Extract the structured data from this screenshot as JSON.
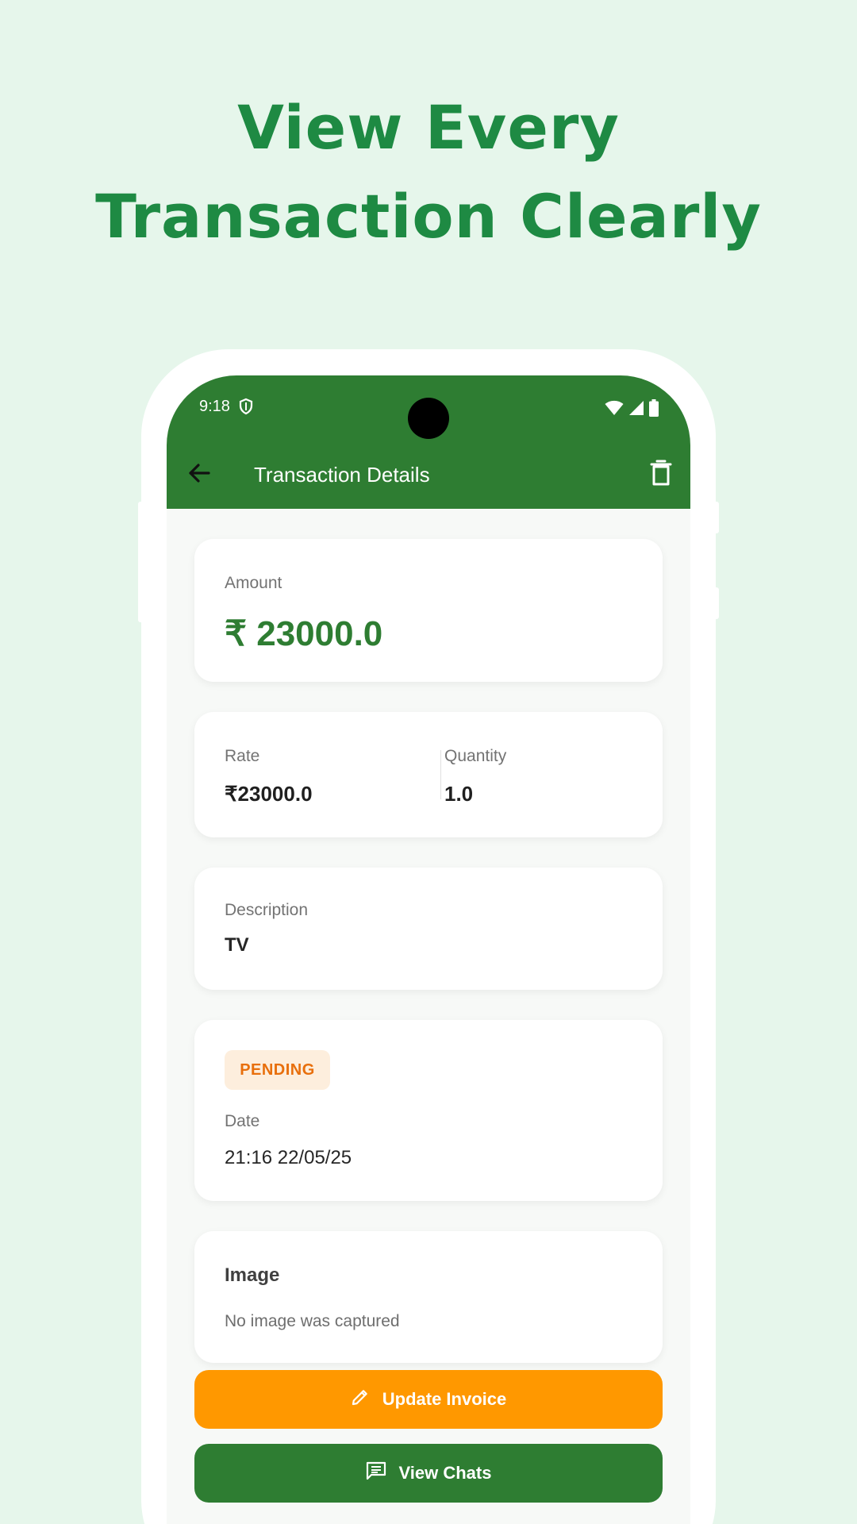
{
  "headline": {
    "line1": "View Every",
    "line2": "Transaction Clearly"
  },
  "status_bar": {
    "time": "9:18"
  },
  "appbar": {
    "title": "Transaction Details"
  },
  "amount": {
    "label": "Amount",
    "value": "₹ 23000.0"
  },
  "rate": {
    "label": "Rate",
    "value": "₹23000.0"
  },
  "quantity": {
    "label": "Quantity",
    "value": "1.0"
  },
  "description": {
    "label": "Description",
    "value": "TV"
  },
  "status": {
    "badge": "PENDING",
    "date_label": "Date",
    "date_value": "21:16 22/05/25"
  },
  "image": {
    "title": "Image",
    "note": "No image was captured"
  },
  "actions": {
    "update_label": "Update Invoice",
    "chats_label": "View Chats"
  },
  "colors": {
    "primary": "#2e7d32",
    "accent": "#ff9800",
    "pending_text": "#e86f0c",
    "pending_bg": "#fdeedd",
    "headline": "#1e8a43",
    "background": "#e6f6eb"
  },
  "icons": [
    "shield-icon",
    "wifi-icon",
    "signal-icon",
    "battery-icon",
    "back-arrow-icon",
    "trash-icon",
    "pencil-icon",
    "chat-icon"
  ]
}
